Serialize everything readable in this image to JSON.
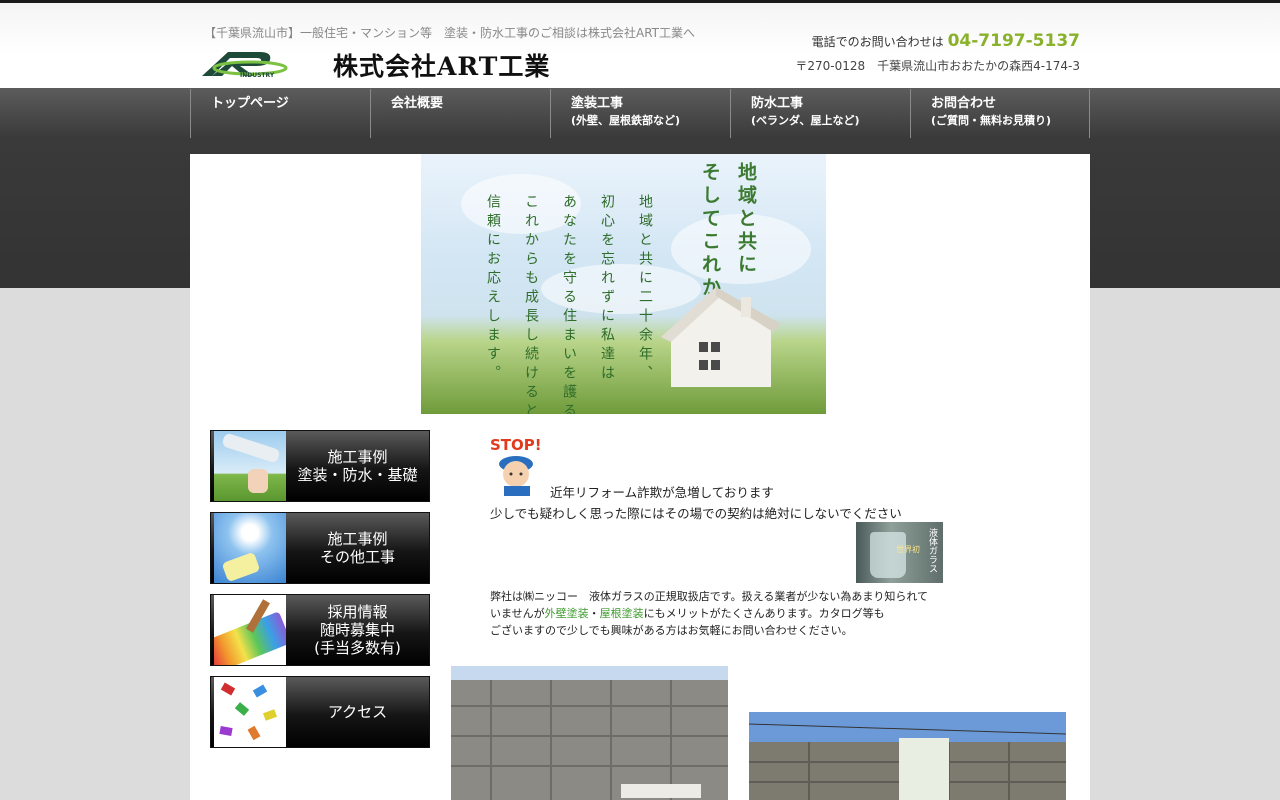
{
  "header": {
    "tagline": "【千葉県流山市】一般住宅・マンション等　塗装・防水工事のご相談は株式会社ART工業へ",
    "logo_text": "INDUSTRY",
    "company_name": "株式会社ART工業",
    "phone_label": "電話でのお問い合わせは",
    "phone_number": "04-7197-5137",
    "address": "〒270-0128　千葉県流山市おおたかの森西4-174-3"
  },
  "nav": [
    {
      "label": "トップページ",
      "sub": ""
    },
    {
      "label": "会社概要",
      "sub": ""
    },
    {
      "label": "塗装工事",
      "sub": "(外壁、屋根鉄部など)"
    },
    {
      "label": "防水工事",
      "sub": "(ベランダ、屋上など)"
    },
    {
      "label": "お問合わせ",
      "sub": "(ご質問・無料お見積り)"
    }
  ],
  "hero": {
    "heading_line1": "地域と共に",
    "heading_line2": "そしてこれからも…",
    "body_lines": [
      "地域と共に二十余年、",
      "初心を忘れずに私達は",
      "あなたを守る住まいを護る為",
      "これからも成長し続けると共に",
      "信頼にお応えします。"
    ]
  },
  "sidebar": [
    {
      "label": "施工事例\n塗装・防水・基礎",
      "thumb": "paint-roller-sky-icon"
    },
    {
      "label": "施工事例\nその他工事",
      "thumb": "paint-roller-sun-icon"
    },
    {
      "label": "採用情報\n随時募集中\n(手当多数有)",
      "thumb": "rainbow-roller-icon"
    },
    {
      "label": "アクセス",
      "thumb": "paint-splash-icon"
    }
  ],
  "notice": {
    "stop_text": "STOP!",
    "line1": "近年リフォーム詐欺が急増しております",
    "line2": "少しでも疑わしく思った際にはその場での契約は絶対にしないでください"
  },
  "glass": {
    "vertical_text": "液体ガラス",
    "small_text": "世界初"
  },
  "paragraph": {
    "line1": "弊社は㈱ニッコー　液体ガラスの正規取扱店です。扱える業者が少ない為あまり知られて",
    "line2_pre": "いませんが",
    "link1": "外壁塗装",
    "sep": "・",
    "link2": "屋根塗装",
    "line2_post": "にもメリットがたくさんあります。カタログ等も",
    "line3": "ございますので少しでも興味がある方はお気軽にお問い合わせください。"
  },
  "colors": {
    "accent_green": "#8ab12a",
    "link_green": "#3b9a2b",
    "nav_dark": "#333333"
  }
}
